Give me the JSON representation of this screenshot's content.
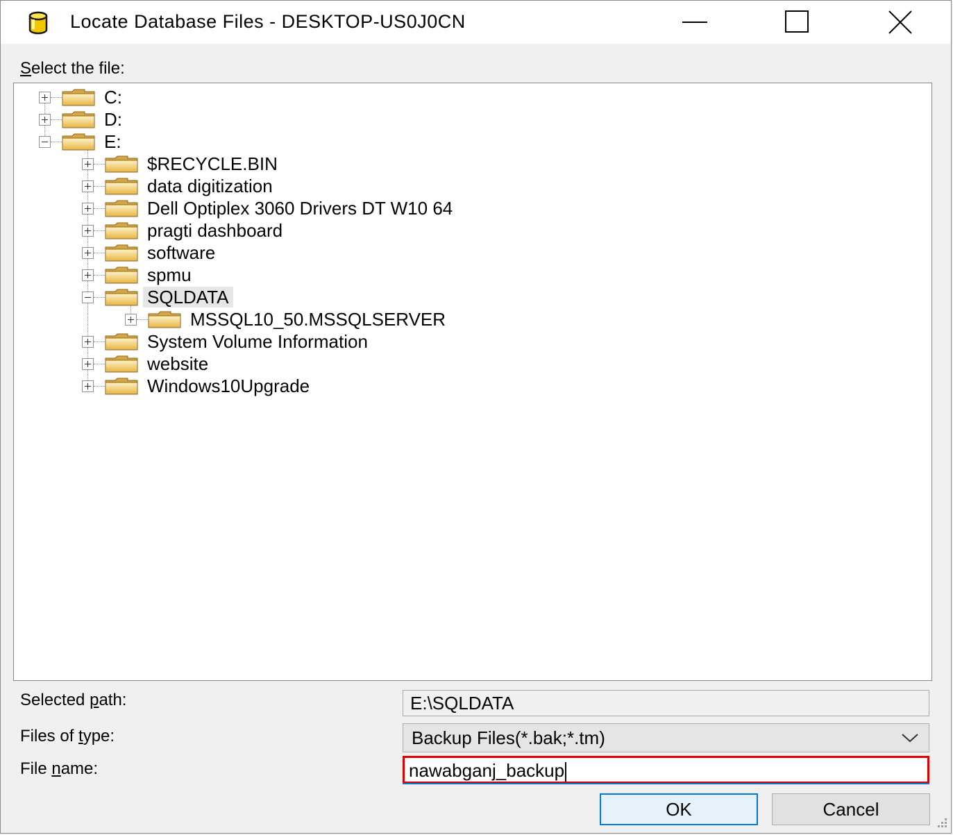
{
  "window": {
    "title": "Locate Database Files - DESKTOP-US0J0CN",
    "icon": "database-icon",
    "controls": [
      "minimize-icon",
      "maximize-icon",
      "close-icon"
    ]
  },
  "tree": {
    "label_prefix": "S",
    "label_rest": "elect the file:",
    "nodes": [
      {
        "label": "C:",
        "expanded": false,
        "level": 0
      },
      {
        "label": "D:",
        "expanded": false,
        "level": 0
      },
      {
        "label": "E:",
        "expanded": true,
        "level": 0
      },
      {
        "label": "$RECYCLE.BIN",
        "expanded": false,
        "level": 1
      },
      {
        "label": "data digitization",
        "expanded": false,
        "level": 1
      },
      {
        "label": "Dell Optiplex 3060 Drivers DT W10 64",
        "expanded": false,
        "level": 1
      },
      {
        "label": "pragti dashboard",
        "expanded": false,
        "level": 1
      },
      {
        "label": "software",
        "expanded": false,
        "level": 1
      },
      {
        "label": "spmu",
        "expanded": false,
        "level": 1
      },
      {
        "label": "SQLDATA",
        "expanded": true,
        "level": 1,
        "selected": true
      },
      {
        "label": "MSSQL10_50.MSSQLSERVER",
        "expanded": false,
        "level": 2
      },
      {
        "label": "System Volume Information",
        "expanded": false,
        "level": 1
      },
      {
        "label": "website",
        "expanded": false,
        "level": 1
      },
      {
        "label": "Windows10Upgrade",
        "expanded": false,
        "level": 1
      }
    ]
  },
  "form": {
    "selected_path_label_a": "Selected ",
    "selected_path_label_u": "p",
    "selected_path_label_b": "ath:",
    "selected_path_value": "E:\\SQLDATA",
    "files_type_label_a": "Files of ",
    "files_type_label_u": "t",
    "files_type_label_b": "ype:",
    "files_type_value": "Backup Files(*.bak;*.tm)",
    "file_name_label_a": "File ",
    "file_name_label_u": "n",
    "file_name_label_b": "ame:",
    "file_name_value": "nawabganj_backup"
  },
  "buttons": {
    "ok": "OK",
    "cancel": "Cancel"
  },
  "colors": {
    "highlight_border": "#e00000",
    "focus_blue": "#0078d7"
  }
}
